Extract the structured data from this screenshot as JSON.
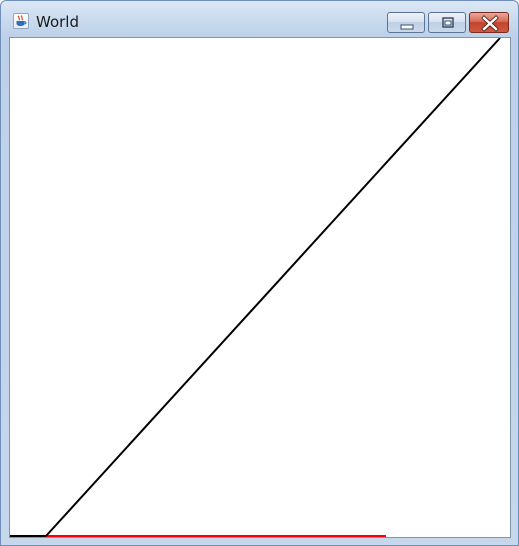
{
  "window": {
    "title": "World",
    "app_icon": "java-cup-icon",
    "controls": {
      "minimize_icon": "minimize-icon",
      "maximize_icon": "maximize-icon",
      "close_icon": "close-icon"
    }
  },
  "canvas": {
    "background": "#ffffff",
    "diagonal_line_color": "#000000",
    "ground_line_color": "#000000",
    "red_segment_color": "#ff0000"
  }
}
